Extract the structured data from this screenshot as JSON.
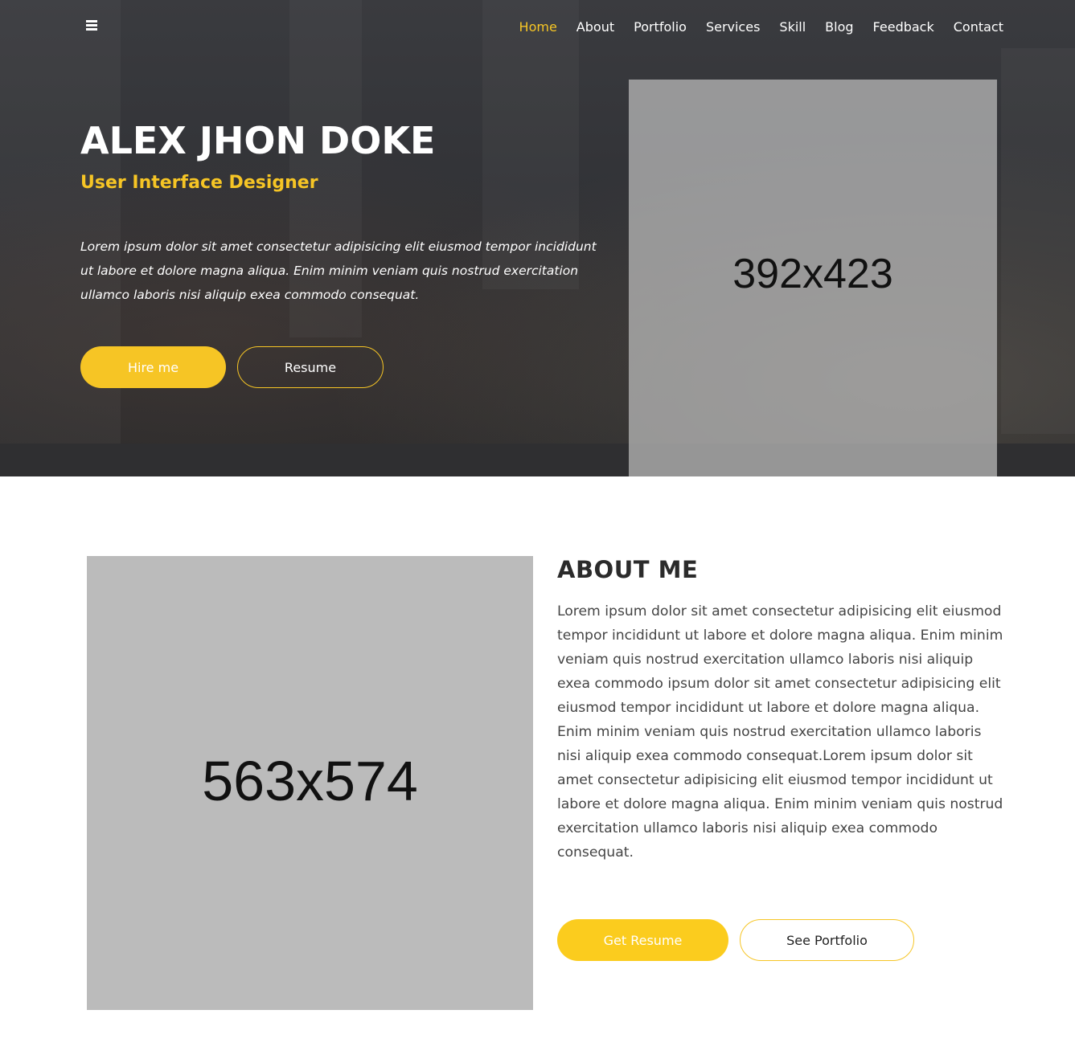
{
  "nav": {
    "items": [
      {
        "label": "Home",
        "active": true
      },
      {
        "label": "About"
      },
      {
        "label": "Portfolio"
      },
      {
        "label": "Services"
      },
      {
        "label": "Skill"
      },
      {
        "label": "Blog"
      },
      {
        "label": "Feedback"
      },
      {
        "label": "Contact"
      }
    ],
    "menu_icon": "hamburger-menu-icon"
  },
  "hero": {
    "name": "ALEX JHON DOKE",
    "role": "User Interface Designer",
    "description": "Lorem ipsum dolor sit amet consectetur adipisicing elit eiusmod tempor incididunt ut labore et dolore magna aliqua. Enim minim veniam quis nostrud exercitation ullamco laboris nisi aliquip exea commodo consequat.",
    "hire_label": "Hire me",
    "resume_label": "Resume",
    "image_placeholder": "392x423"
  },
  "about": {
    "title": "ABOUT ME",
    "text": "Lorem ipsum dolor sit amet consectetur adipisicing elit eiusmod tempor incididunt ut labore et dolore magna aliqua. Enim minim veniam quis nostrud exercitation ullamco laboris nisi aliquip exea commodo ipsum dolor sit amet consectetur adipisicing elit eiusmod tempor incididunt ut labore et dolore magna aliqua. Enim minim veniam quis nostrud exercitation ullamco laboris nisi aliquip exea commodo consequat.Lorem ipsum dolor sit amet consectetur adipisicing elit eiusmod tempor incididunt ut labore et dolore magna aliqua. Enim minim veniam quis nostrud exercitation ullamco laboris nisi aliquip exea commodo consequat.",
    "image_placeholder": "563x574",
    "get_resume_label": "Get Resume",
    "see_portfolio_label": "See Portfolio"
  },
  "colors": {
    "accent": "#f6c525",
    "hero_bg": "#323337",
    "placeholder_gray": "#bbbbbb",
    "heading": "#2b2b2b"
  }
}
